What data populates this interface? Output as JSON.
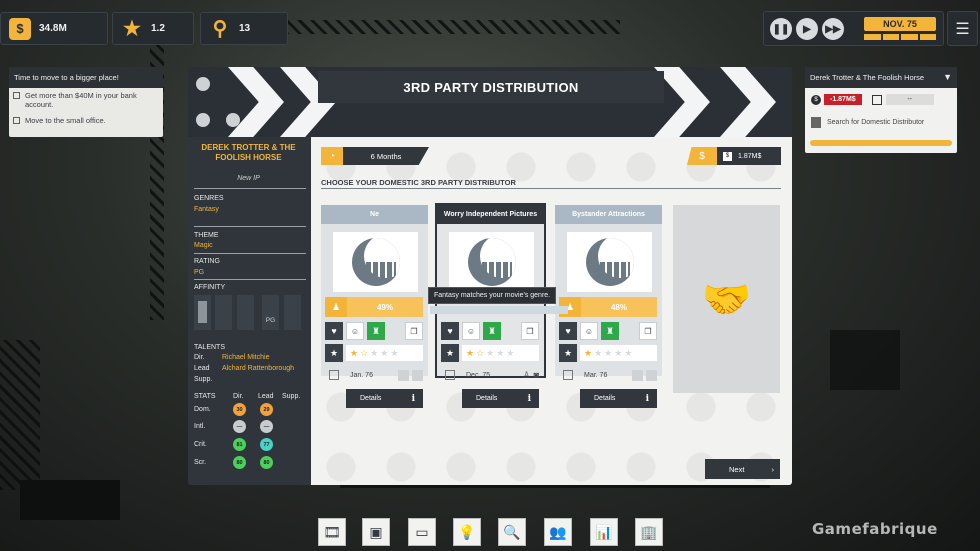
{
  "hud": {
    "money": "34.8M",
    "rating": "1.2",
    "research": "13",
    "date": "NOV. 75"
  },
  "objectives": {
    "title": "Time to move to a bigger place!",
    "items": [
      "Get more than $40M in your bank account.",
      "Move to the small office."
    ]
  },
  "task": {
    "title": "Derek Trotter & The Foolish Horse",
    "cost": "-1.87M$",
    "date": "--",
    "status": "Search for Domestic Distributor"
  },
  "window": {
    "title": "3RD PARTY DISTRIBUTION"
  },
  "movie": {
    "title_line1": "DEREK TROTTER & THE",
    "title_line2": "FOOLISH HORSE",
    "subtitle": "New IP",
    "genres_label": "GENRES",
    "genres_value": "Fantasy",
    "theme_label": "THEME",
    "theme_value": "Magic",
    "rating_label": "RATING",
    "rating_value": "PG",
    "affinity_label": "AFFINITY",
    "affinity_pg": "PG",
    "talents_label": "TALENTS",
    "dir_label": "Dir.",
    "dir_value": "Richael Mitchie",
    "lead_label": "Lead",
    "lead_value": "Alchard Rattenborough",
    "supp_label": "Supp.",
    "stats_label": "STATS",
    "stats_cols": [
      "Dir.",
      "Lead",
      "Supp."
    ],
    "stats_rows": [
      {
        "label": "Dom.",
        "dir": "30",
        "lead": "29"
      },
      {
        "label": "Intl.",
        "dir": "—",
        "lead": "—"
      },
      {
        "label": "Crit.",
        "dir": "81",
        "lead": "77"
      },
      {
        "label": "Scr.",
        "dir": "80",
        "lead": "80"
      }
    ]
  },
  "distribution": {
    "duration": "6 Months",
    "cost": "1.87M$",
    "cost_symbol": "$",
    "heading": "CHOOSE YOUR DOMESTIC 3RD PARTY DISTRIBUTOR",
    "details_label": "Details",
    "next_label": "Next",
    "cards": [
      {
        "name": "Ne",
        "pct": "49%",
        "stars": 1.5,
        "date": "Jan. 76"
      },
      {
        "name": "Worry Independent Pictures",
        "pct": "",
        "stars": 1.5,
        "date": "Dec. 75"
      },
      {
        "name": "Bystander Attractions",
        "pct": "48%",
        "stars": 1,
        "date": "Mar. 76"
      }
    ],
    "tooltip": "Fantasy matches your movie's genre."
  },
  "watermark": "Gamefabrique",
  "colors": {
    "accent": "#f2b53a",
    "dark": "#2f353b",
    "negative": "#c8202a",
    "positive": "#2ea84a"
  }
}
